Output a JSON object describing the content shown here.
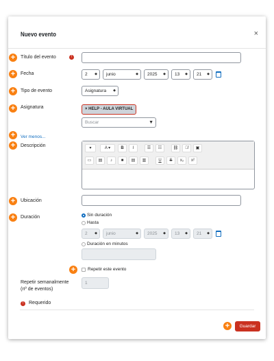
{
  "modal": {
    "title": "Nuevo evento",
    "close_glyph": "×"
  },
  "labels": {
    "titulo": "Título del evento",
    "fecha": "Fecha",
    "tipo": "Tipo de evento",
    "asignatura": "Asignatura",
    "descripcion": "Descripción",
    "ubicacion": "Ubicación",
    "duracion": "Duración",
    "repetir_semanal_1": "Repetir semanalmente",
    "repetir_semanal_2": "(nº de eventos)",
    "requerido": "Requerido"
  },
  "fecha": {
    "day": "2",
    "month": "junio",
    "year": "2025",
    "hour": "13",
    "minute": "21"
  },
  "tipo_evento": {
    "value": "Asignatura"
  },
  "asignatura": {
    "chip": "× HELP - AULA VIRTUAL",
    "search_placeholder": "Buscar"
  },
  "ver_menos": "Ver menos...",
  "editor": {
    "row1": [
      "▾",
      "A ▾",
      "B",
      "I",
      "☰",
      "☷",
      "⛓",
      "⛓̸",
      "▣"
    ],
    "row2": [
      "▭",
      "▤",
      "♪",
      "■",
      "▤",
      "▥",
      "U",
      "S",
      "x₂",
      "x²"
    ]
  },
  "duracion": {
    "sin": "Sin duración",
    "hasta": "Hasta",
    "minutos": "Duración en minutos",
    "hasta_fecha": {
      "day": "2",
      "month": "junio",
      "year": "2025",
      "hour": "13",
      "minute": "21"
    }
  },
  "repetir": {
    "label": "Repetir este evento",
    "count": "1"
  },
  "footer": {
    "save": "Guardar"
  },
  "colors": {
    "accent": "#f98012",
    "primary": "#0f6cbf",
    "danger": "#ca3120"
  }
}
